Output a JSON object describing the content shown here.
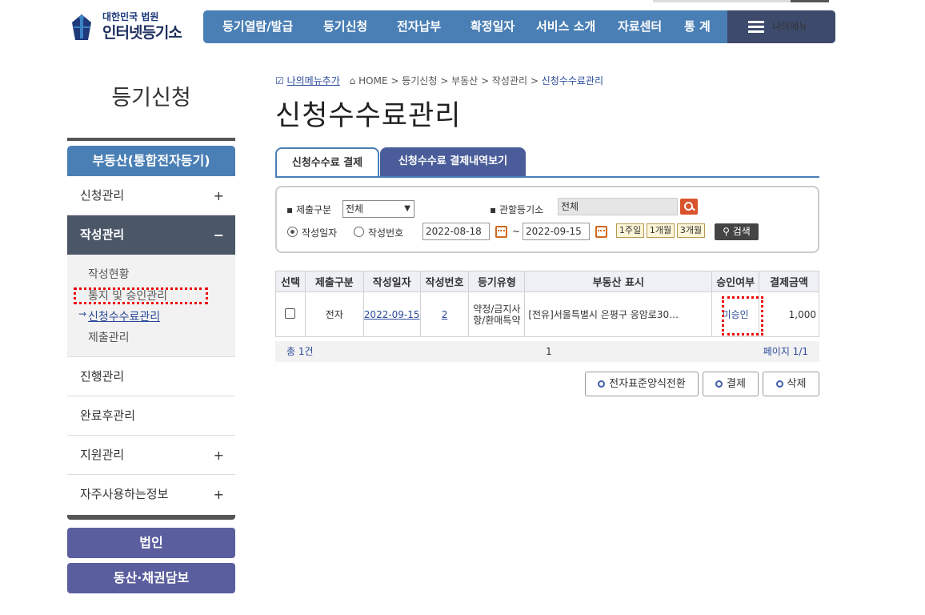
{
  "logo": {
    "subtitle": "대한민국 법원",
    "title": "인터넷등기소"
  },
  "gnb": {
    "items": [
      "등기열람/발급",
      "등기신청",
      "전자납부",
      "확정일자",
      "서비스 소개",
      "자료센터",
      "통 계"
    ],
    "my_menu": "나의메뉴"
  },
  "sidebar": {
    "title": "등기신청",
    "section": "부동산(통합전자등기)",
    "items": [
      {
        "label": "신청관리",
        "toggle": "+"
      },
      {
        "label": "작성관리",
        "toggle": "−"
      },
      {
        "label": "진행관리",
        "toggle": ""
      },
      {
        "label": "완료후관리",
        "toggle": ""
      },
      {
        "label": "지원관리",
        "toggle": "+"
      },
      {
        "label": "자주사용하는정보",
        "toggle": "+"
      }
    ],
    "sub_items": [
      "작성현황",
      "통지 및 승인관리",
      "신청수수료관리",
      "제출관리"
    ],
    "bottom_buttons": [
      "법인",
      "동산·채권담보"
    ]
  },
  "breadcrumb": {
    "add_label": "나의메뉴추가",
    "path": "HOME > 등기신청 > 부동산 > 작성관리 >",
    "current": "신청수수료관리"
  },
  "page_title": "신청수수료관리",
  "tabs": [
    "신청수수료 결제",
    "신청수수료 결제내역보기"
  ],
  "search": {
    "submit_type_label": "제출구분",
    "submit_type_value": "전체",
    "office_label": "관할등기소",
    "office_value": "전체",
    "radio_date": "작성일자",
    "radio_number": "작성번호",
    "date_from": "2022-08-18",
    "tilde": "~",
    "date_to": "2022-09-15",
    "period_buttons": [
      "1주일",
      "1개월",
      "3개월"
    ],
    "search_button": "검색"
  },
  "table": {
    "headers": [
      "선택",
      "제출구분",
      "작성일자",
      "작성번호",
      "등기유형",
      "부동산 표시",
      "승인여부",
      "결제금액"
    ],
    "rows": [
      {
        "submit_type": "전자",
        "date": "2022-09-15",
        "number": "2",
        "type": "약정/금지사항/환매특약",
        "property": "[전유]서울특별시 은평구 응암로30…",
        "approval": "미승인",
        "amount": "1,000"
      }
    ],
    "total": "총 1건",
    "page_current": "1",
    "page_info": "페이지 1/1"
  },
  "actions": [
    "전자표준양식전환",
    "결제",
    "삭제"
  ]
}
